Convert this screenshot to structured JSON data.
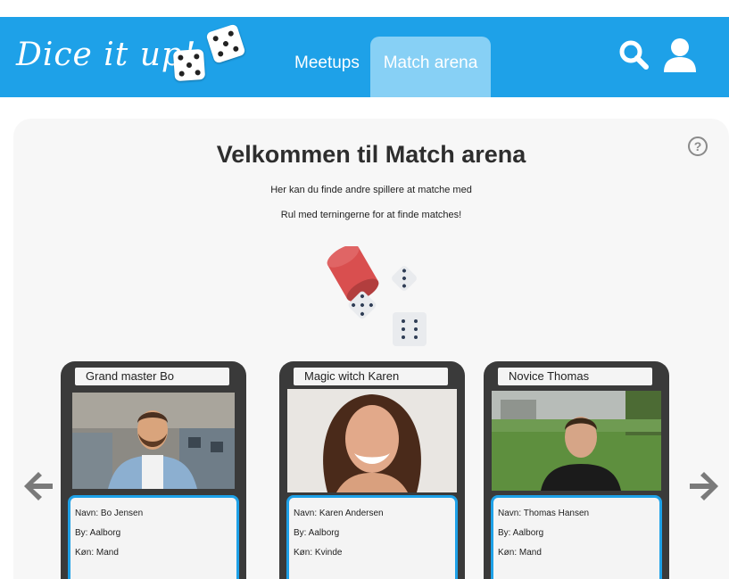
{
  "header": {
    "logo": "Dice it up!",
    "nav": [
      {
        "label": "Meetups"
      },
      {
        "label": "Match arena"
      }
    ],
    "accent_color": "#1ea1e8",
    "active_tab_color": "#87d0f5",
    "search_icon": "search-icon",
    "user_icon": "user-icon"
  },
  "main": {
    "title": "Velkommen til Match arena",
    "subtitle1": "Her kan du finde andre spillere at matche med",
    "subtitle2": "Rul med terningerne for at finde matches!",
    "help_icon": "?",
    "roll_icon": "dice-cup-icon"
  },
  "cards": [
    {
      "title": "Grand master Bo",
      "name": "Navn: Bo Jensen",
      "city": "By: Aalborg",
      "gender": "Køn: Mand",
      "photo": "man-glasses-beard-office"
    },
    {
      "title": "Magic witch Karen",
      "name": "Navn: Karen Andersen",
      "city": "By: Aalborg",
      "gender": "Køn: Kvinde",
      "photo": "woman-curly-hair-smiling"
    },
    {
      "title": "Novice Thomas",
      "name": "Navn: Thomas Hansen",
      "city": "By: Aalborg",
      "gender": "Køn: Mand",
      "photo": "man-outdoor-park"
    }
  ],
  "arrows": {
    "prev": "arrow-left-icon",
    "next": "arrow-right-icon"
  }
}
